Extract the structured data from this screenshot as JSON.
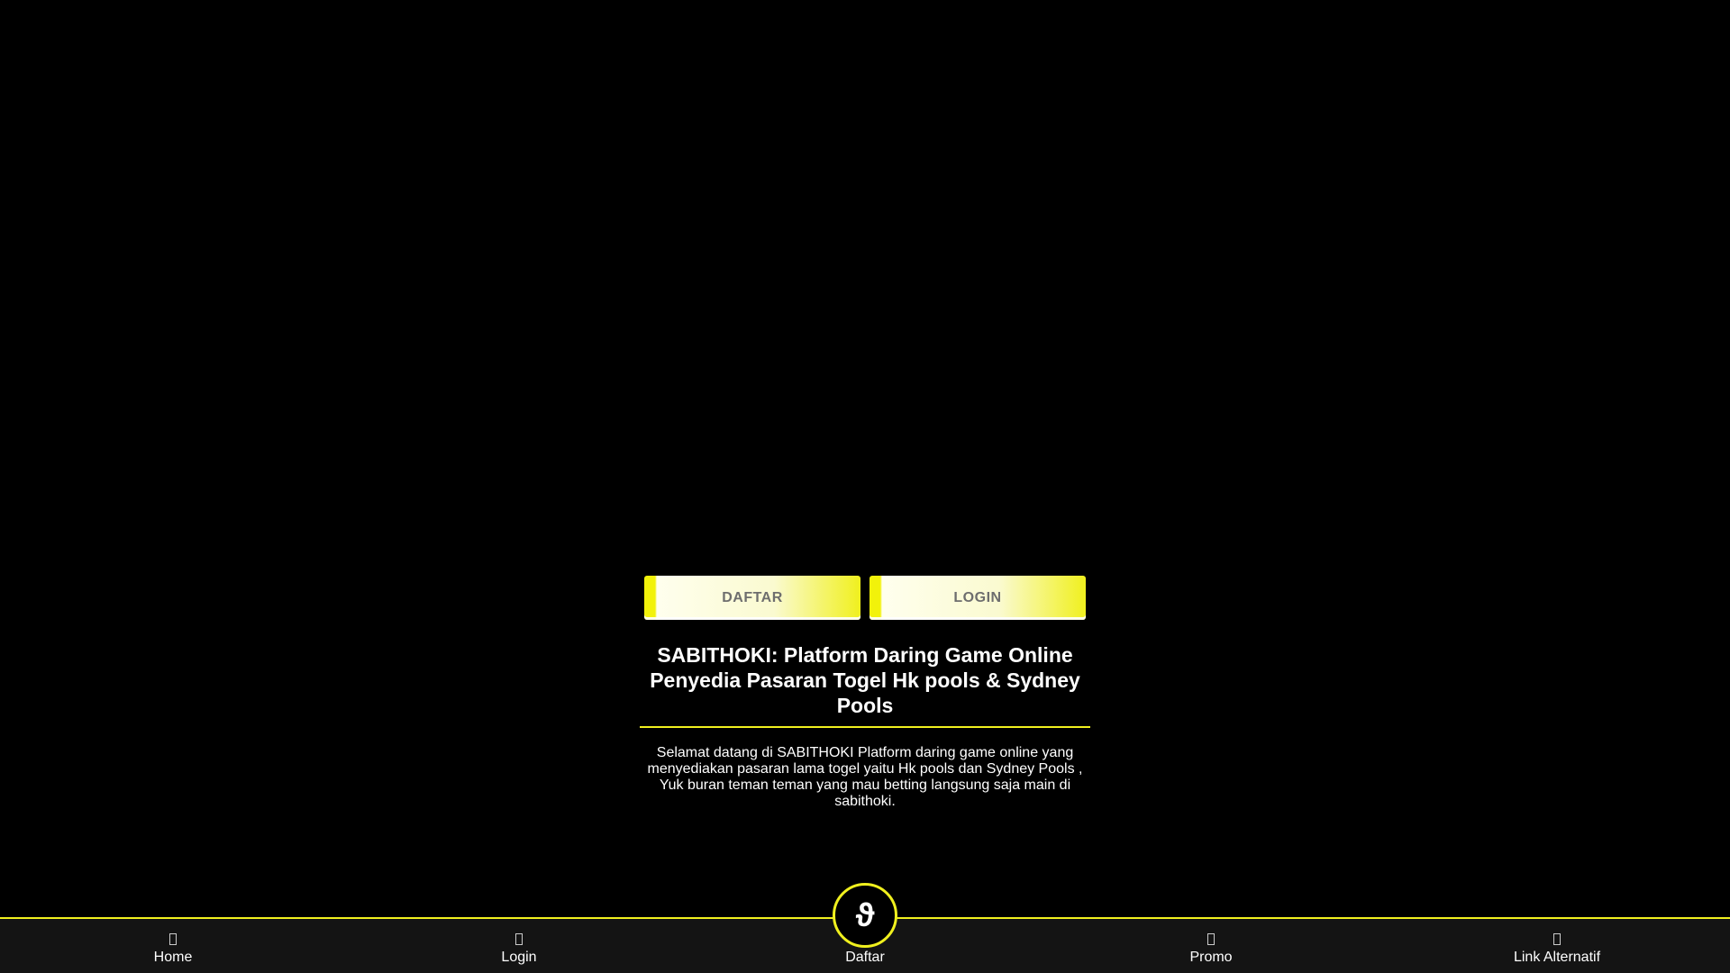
{
  "buttons": {
    "daftar_label": "DAFTAR",
    "login_label": "LOGIN"
  },
  "article": {
    "title": "SABITHOKI: Platform Daring Game Online Penyedia Pasaran Togel Hk pools & Sydney Pools",
    "description": "Selamat datang di SABITHOKI Platform daring game online yang menyediakan pasaran lama togel yaitu Hk pools dan Sydney Pools , Yuk buran teman teman yang mau betting langsung saja main di sabithoki."
  },
  "bottom_nav": {
    "center_badge": "ϑ",
    "items": [
      {
        "label": "Home",
        "icon": "home-icon"
      },
      {
        "label": "Login",
        "icon": "login-icon"
      },
      {
        "label": "Daftar",
        "icon": "daftar-icon"
      },
      {
        "label": "Promo",
        "icon": "promo-icon"
      },
      {
        "label": "Link Alternatif",
        "icon": "link-icon"
      }
    ]
  },
  "colors": {
    "background": "#000000",
    "accent": "#f0f01e",
    "nav_background": "#141414"
  }
}
